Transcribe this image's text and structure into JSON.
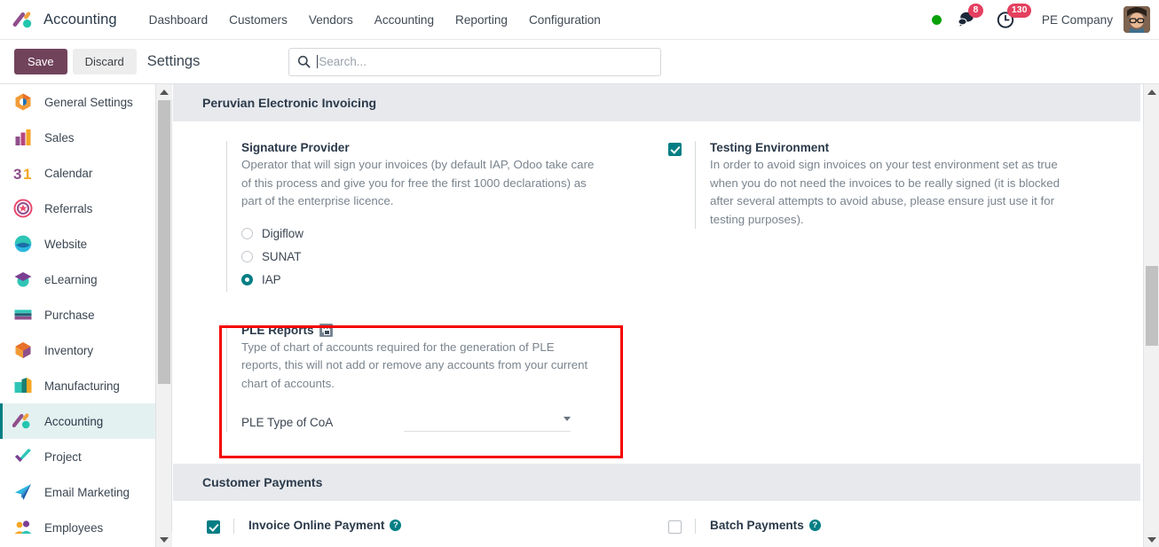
{
  "navbar": {
    "app_icon": "accounting-app-icon",
    "brand": "Accounting",
    "menu": [
      {
        "label": "Dashboard",
        "name": "dashboard"
      },
      {
        "label": "Customers",
        "name": "customers"
      },
      {
        "label": "Vendors",
        "name": "vendors"
      },
      {
        "label": "Accounting",
        "name": "accounting"
      },
      {
        "label": "Reporting",
        "name": "reporting"
      },
      {
        "label": "Configuration",
        "name": "configuration"
      }
    ],
    "status_color": "#08a10a",
    "messages_icon": "chat-bubble-icon",
    "messages_count": "8",
    "activities_icon": "clock-icon",
    "activities_count": "130",
    "company": "PE Company",
    "avatar": "user-avatar"
  },
  "controlpanel": {
    "save_label": "Save",
    "discard_label": "Discard",
    "title": "Settings",
    "search_icon": "search-icon",
    "search_value": "",
    "search_placeholder": "Search..."
  },
  "sidebar": {
    "items": [
      {
        "label": "General Settings",
        "icon": "general-settings-icon",
        "active": false
      },
      {
        "label": "Sales",
        "icon": "sales-icon",
        "active": false
      },
      {
        "label": "Calendar",
        "icon": "calendar-icon",
        "active": false
      },
      {
        "label": "Referrals",
        "icon": "referrals-icon",
        "active": false
      },
      {
        "label": "Website",
        "icon": "website-icon",
        "active": false
      },
      {
        "label": "eLearning",
        "icon": "elearning-icon",
        "active": false
      },
      {
        "label": "Purchase",
        "icon": "purchase-icon",
        "active": false
      },
      {
        "label": "Inventory",
        "icon": "inventory-icon",
        "active": false
      },
      {
        "label": "Manufacturing",
        "icon": "manufacturing-icon",
        "active": false
      },
      {
        "label": "Accounting",
        "icon": "accounting-icon",
        "active": true
      },
      {
        "label": "Project",
        "icon": "project-icon",
        "active": false
      },
      {
        "label": "Email Marketing",
        "icon": "email-marketing-icon",
        "active": false
      },
      {
        "label": "Employees",
        "icon": "employees-icon",
        "active": false
      }
    ]
  },
  "settings": {
    "section1": {
      "title": "Peruvian Electronic Invoicing",
      "signature": {
        "title": "Signature Provider",
        "description": "Operator that will sign your invoices (by default IAP, Odoo take care of this process and give you for free the first 1000 declarations) as part of the enterprise licence.",
        "options": [
          {
            "label": "Digiflow",
            "selected": false
          },
          {
            "label": "SUNAT",
            "selected": false
          },
          {
            "label": "IAP",
            "selected": true
          }
        ]
      },
      "testing": {
        "title": "Testing Environment",
        "description": "In order to avoid sign invoices on your test environment set as true when you do not need the invoices to be really signed (it is blocked after several attempts to avoid abuse, please ensure just use it for testing purposes).",
        "checked": true
      },
      "ple": {
        "title": "PLE Reports",
        "company_icon": "company-building-icon",
        "description": "Type of chart of accounts required for the generation of PLE reports, this will not add or remove any accounts from your current chart of accounts.",
        "field_label": "PLE Type of CoA",
        "field_value": "",
        "caret_icon": "chevron-down-icon",
        "highlight_color": "#f40000"
      }
    },
    "section2": {
      "title": "Customer Payments",
      "items": [
        {
          "label": "Invoice Online Payment",
          "checked": true,
          "help_icon": "help-circle-icon"
        },
        {
          "label": "Batch Payments",
          "checked": false,
          "help_icon": "help-circle-icon"
        }
      ]
    }
  },
  "scrollbars": {
    "sidebar": {
      "up_icon": "scroll-up-arrow-icon",
      "down_icon": "scroll-down-arrow-icon"
    },
    "main": {
      "up_icon": "scroll-up-arrow-icon",
      "down_icon": "scroll-down-arrow-icon"
    }
  },
  "theme": {
    "accent": "#017e84",
    "save_button": "#71435b",
    "section_header_bg": "#e7e9ed",
    "highlight": "#f40000"
  }
}
